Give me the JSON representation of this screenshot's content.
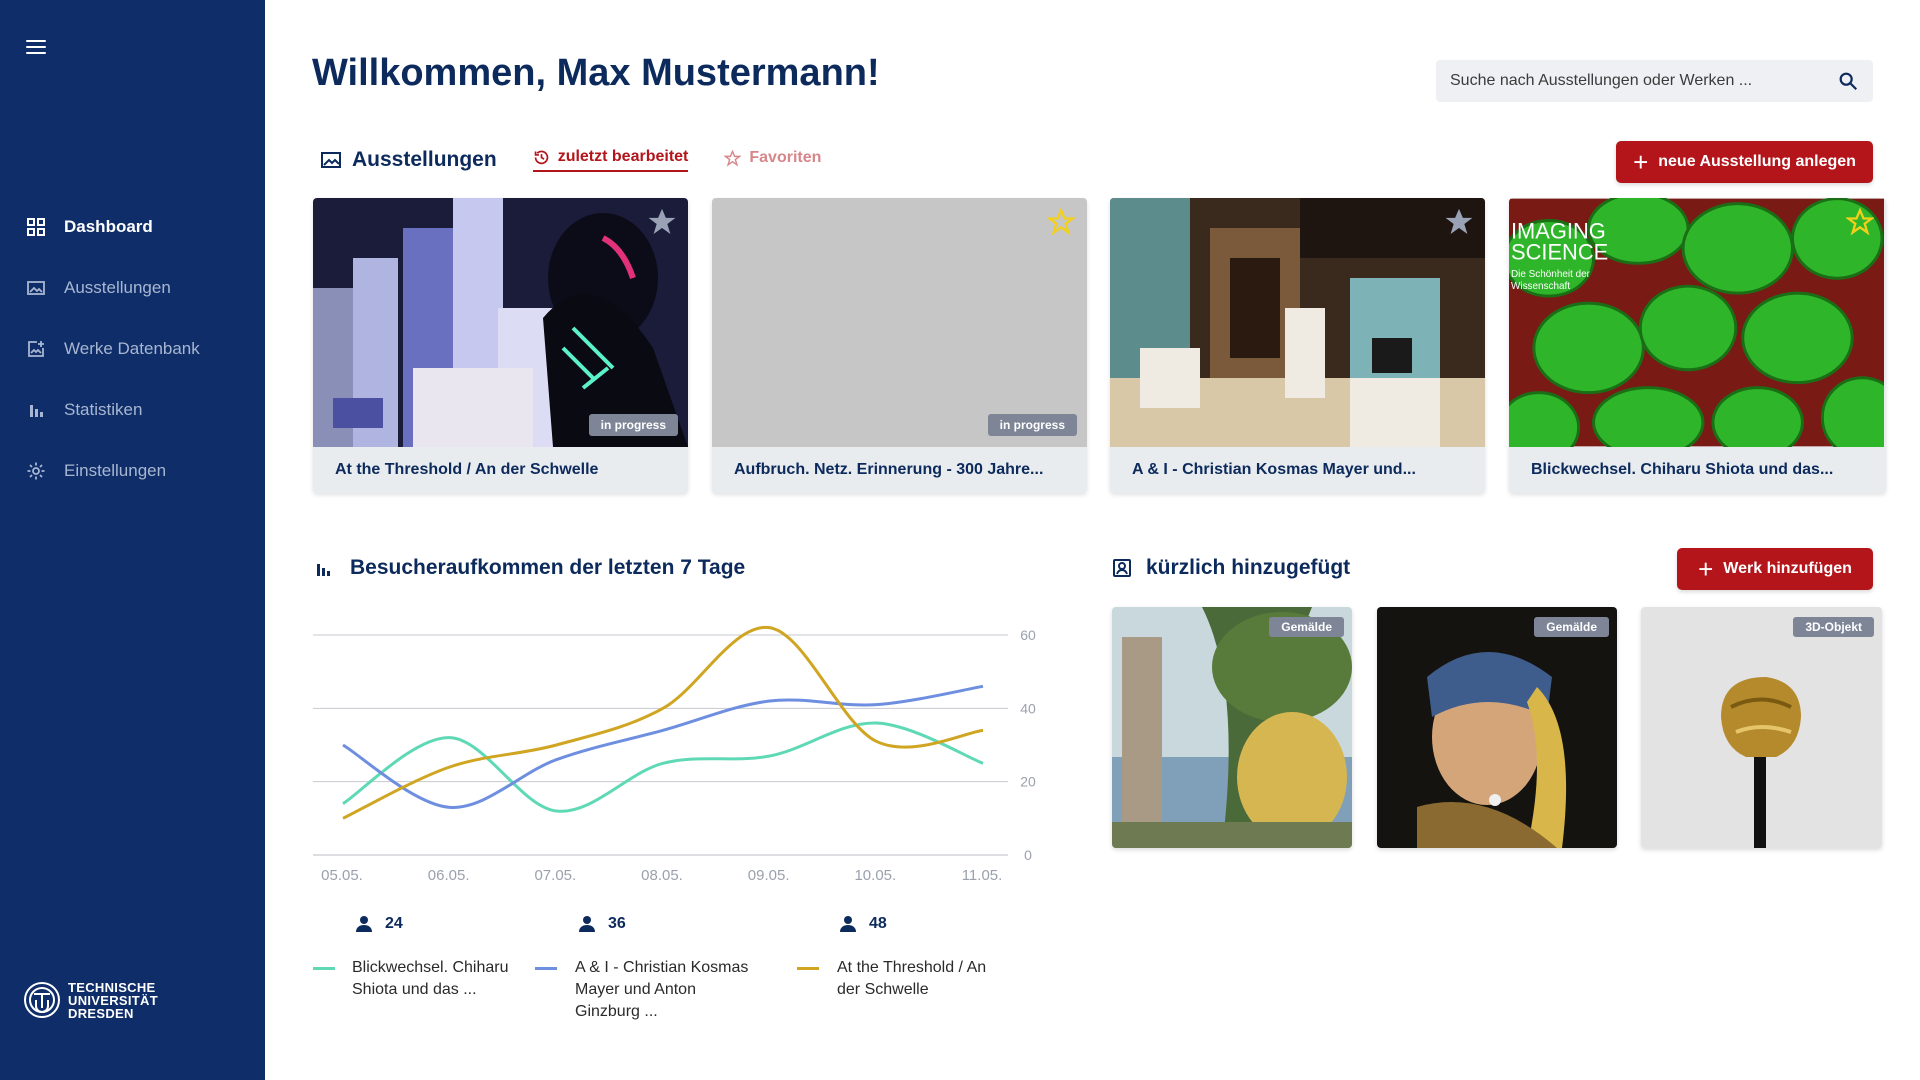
{
  "sidebar": {
    "menu_icon": "hamburger-menu-icon",
    "items": [
      {
        "label": "Dashboard",
        "icon": "dashboard-grid-icon",
        "active": true
      },
      {
        "label": "Ausstellungen",
        "icon": "gallery-image-icon",
        "active": false
      },
      {
        "label": "Werke Datenbank",
        "icon": "image-add-icon",
        "active": false
      },
      {
        "label": "Statistiken",
        "icon": "bar-chart-icon",
        "active": false
      },
      {
        "label": "Einstellungen",
        "icon": "gear-icon",
        "active": false
      }
    ],
    "logo": {
      "line1": "TECHNISCHE",
      "line2": "UNIVERSITÄT",
      "line3": "DRESDEN"
    }
  },
  "header": {
    "title": "Willkommen, Max Mustermann!",
    "search_placeholder": "Suche nach Ausstellungen oder Werken ..."
  },
  "exhibitions": {
    "heading": "Ausstellungen",
    "tabs": [
      {
        "label": "zuletzt bearbeitet",
        "icon": "history-icon",
        "active": true
      },
      {
        "label": "Favoriten",
        "icon": "star-outline-icon",
        "active": false
      }
    ],
    "new_button": "neue Ausstellung anlegen",
    "cards": [
      {
        "title": "At the Threshold / An der Schwelle",
        "badge": "in progress",
        "favorite": false
      },
      {
        "title": "Aufbruch. Netz. Erinnerung - 300 Jahre...",
        "badge": "in progress",
        "favorite": true
      },
      {
        "title": "A & I - Christian Kosmas Mayer und...",
        "badge": "",
        "favorite": false
      },
      {
        "title": "Blickwechsel. Chiharu Shiota und das...",
        "badge": "",
        "favorite": true,
        "poster_line1": "IMAGING",
        "poster_line2": "SCIENCE",
        "poster_sub1": "Die Schönheit der",
        "poster_sub2": "Wissenschaft"
      }
    ]
  },
  "visitors": {
    "heading": "Besucheraufkommen der letzten 7 Tage",
    "legend": [
      {
        "count": "24",
        "label": "Blickwechsel. Chiharu Shiota und das ...",
        "color": "#5fd9b5"
      },
      {
        "count": "36",
        "label": "A & I - Christian Kosmas Mayer und Anton Ginzburg ...",
        "color": "#6e8ee0"
      },
      {
        "count": "48",
        "label": "At the Threshold / An der Schwelle",
        "color": "#cfa521"
      }
    ]
  },
  "chart_data": {
    "type": "line",
    "x": [
      "05.05.",
      "06.05.",
      "07.05.",
      "08.05.",
      "09.05.",
      "10.05.",
      "11.05."
    ],
    "yticks": [
      "0",
      "20",
      "40",
      "60"
    ],
    "ylim": [
      0,
      60
    ],
    "grid": true,
    "series": [
      {
        "name": "Blickwechsel. Chiharu Shiota und das ...",
        "color": "#5fd9b5",
        "values": [
          14,
          32,
          12,
          25,
          27,
          36,
          25
        ]
      },
      {
        "name": "A & I - Christian Kosmas Mayer und Anton Ginzburg ...",
        "color": "#6e8ee0",
        "values": [
          30,
          13,
          26,
          34,
          42,
          41,
          46
        ]
      },
      {
        "name": "At the Threshold / An der Schwelle",
        "color": "#cfa521",
        "values": [
          10,
          24,
          30,
          40,
          62,
          31,
          34
        ]
      }
    ]
  },
  "recent": {
    "heading": "kürzlich hinzugefügt",
    "add_button": "Werk hinzufügen",
    "works": [
      {
        "badge": "Gemälde"
      },
      {
        "badge": "Gemälde"
      },
      {
        "badge": "3D-Objekt"
      }
    ]
  },
  "colors": {
    "sidebar": "#0f2d68",
    "accent": "#b3151b",
    "title": "#0c2a5c"
  }
}
